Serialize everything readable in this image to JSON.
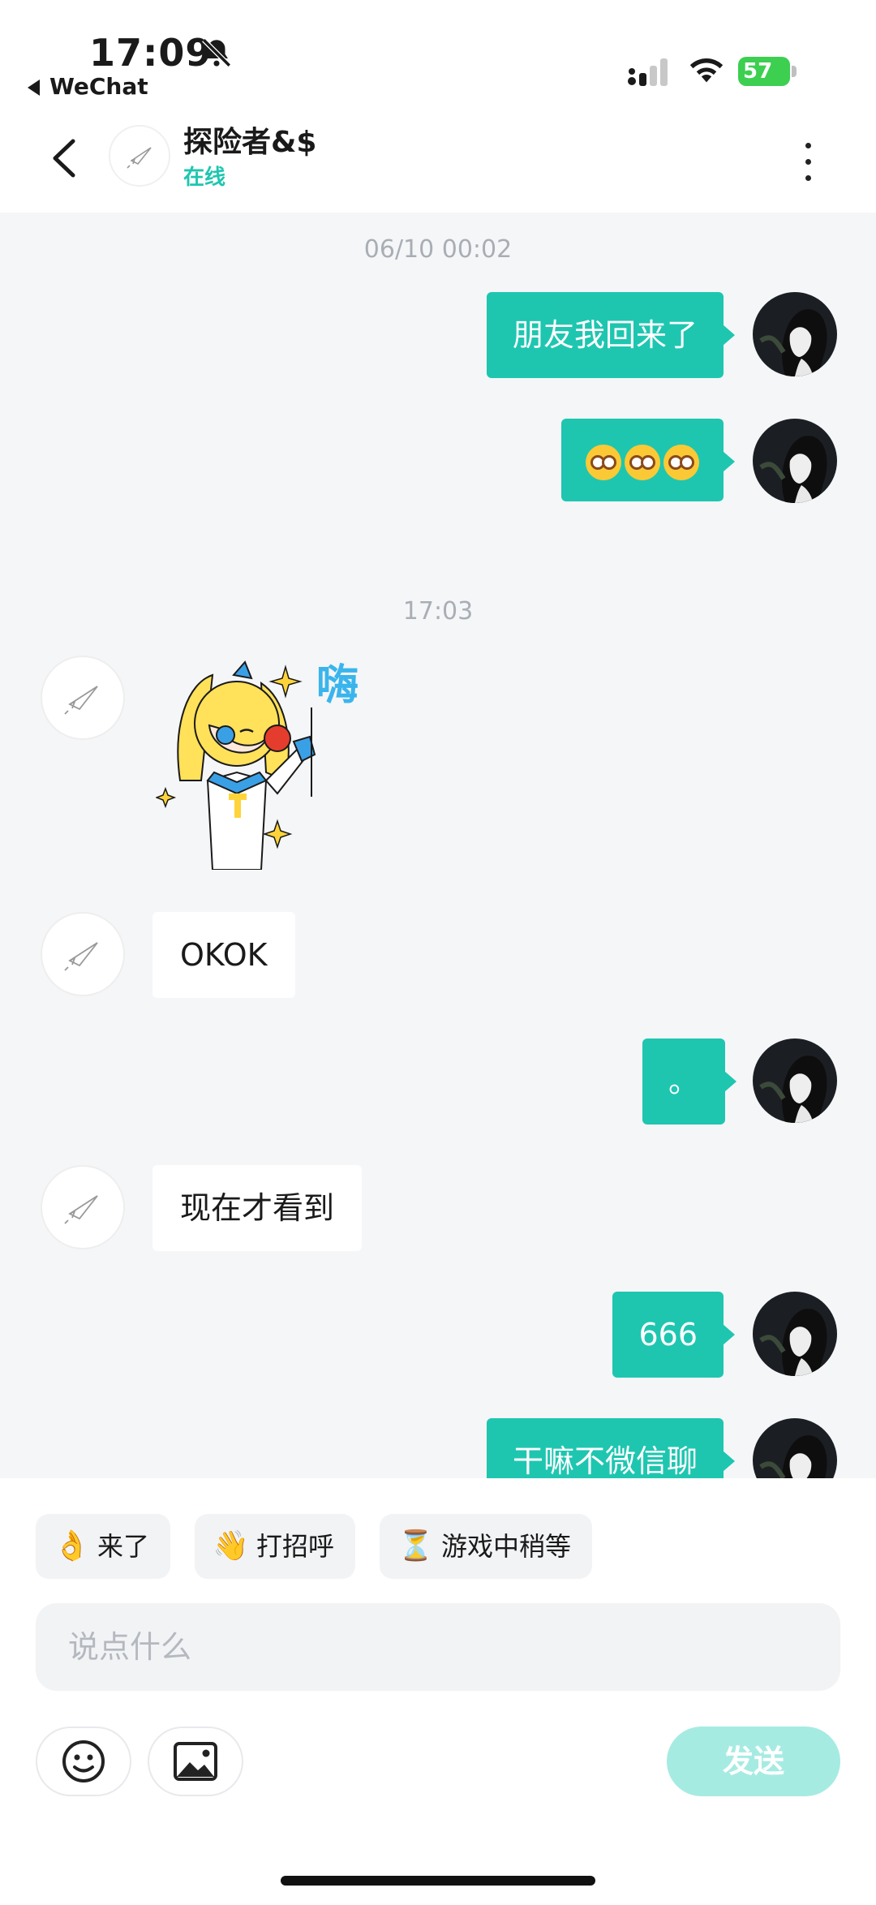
{
  "status_bar": {
    "time": "17:09",
    "back_app": "WeChat",
    "battery_level": "57"
  },
  "header": {
    "contact_name": "探险者&$",
    "contact_status": "在线"
  },
  "messages": [
    {
      "type": "timestamp",
      "text": "06/10 00:02"
    },
    {
      "type": "text",
      "sender": "me",
      "text": "朋友我回来了"
    },
    {
      "type": "emoji",
      "sender": "me",
      "emoji_name": "dizzy-face-emoji",
      "count": 3
    },
    {
      "type": "timestamp",
      "text": "17:03"
    },
    {
      "type": "sticker",
      "sender": "other",
      "sticker_text": "嗨"
    },
    {
      "type": "text",
      "sender": "other",
      "text": "OKOK"
    },
    {
      "type": "text",
      "sender": "me",
      "text": "。"
    },
    {
      "type": "text",
      "sender": "other",
      "text": "现在才看到"
    },
    {
      "type": "text",
      "sender": "me",
      "text": "666"
    },
    {
      "type": "text",
      "sender": "me",
      "text": "干嘛不微信聊"
    }
  ],
  "quick_replies": [
    {
      "icon": "ok-hand-emoji",
      "glyph": "👌",
      "label": "来了"
    },
    {
      "icon": "waving-hand-emoji",
      "glyph": "👋",
      "label": "打招呼"
    },
    {
      "icon": "hourglass-emoji",
      "glyph": "⏳",
      "label": "游戏中稍等"
    }
  ],
  "composer": {
    "placeholder": "说点什么",
    "send_label": "发送"
  },
  "colors": {
    "accent": "#1ec6b0",
    "send_disabled": "#a6ebe2",
    "chat_bg": "#f5f6f8"
  }
}
